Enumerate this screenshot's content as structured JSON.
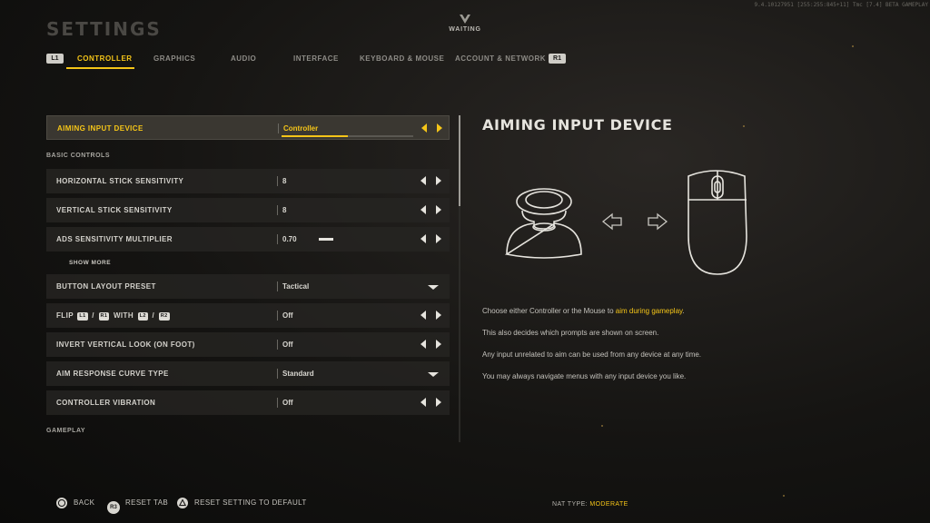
{
  "page_title": "SETTINGS",
  "status": "WAITING",
  "build_info": "9.4.10127951 [255:255:845+11] Tmc [7.4] BETA GAMEPLAY",
  "tabs": {
    "left_bumper": "L1",
    "right_bumper": "R1",
    "items": [
      "CONTROLLER",
      "GRAPHICS",
      "AUDIO",
      "INTERFACE",
      "KEYBOARD & MOUSE",
      "ACCOUNT & NETWORK"
    ],
    "active": "CONTROLLER"
  },
  "settings": {
    "aiming_input_device": {
      "label": "AIMING INPUT DEVICE",
      "value": "Controller",
      "progress": 0.5
    },
    "basic_controls_heading": "BASIC CONTROLS",
    "horizontal_sensitivity": {
      "label": "HORIZONTAL STICK SENSITIVITY",
      "value": "8"
    },
    "vertical_sensitivity": {
      "label": "VERTICAL STICK SENSITIVITY",
      "value": "8"
    },
    "ads_multiplier": {
      "label": "ADS SENSITIVITY MULTIPLIER",
      "value": "0.70"
    },
    "show_more": "SHOW MORE",
    "button_layout": {
      "label": "BUTTON LAYOUT PRESET",
      "value": "Tactical"
    },
    "flip": {
      "label_flip": "FLIP",
      "chip_l1": "L1",
      "slash": "/",
      "chip_r1": "R1",
      "label_with": "WITH",
      "chip_l2": "L2",
      "chip_r2": "R2",
      "value": "Off"
    },
    "invert_vertical": {
      "label": "INVERT VERTICAL LOOK (ON FOOT)",
      "value": "Off"
    },
    "aim_response": {
      "label": "AIM RESPONSE CURVE TYPE",
      "value": "Standard"
    },
    "controller_vibration": {
      "label": "CONTROLLER VIBRATION",
      "value": "Off"
    },
    "gameplay_heading": "GAMEPLAY"
  },
  "detail": {
    "title": "AIMING INPUT DEVICE",
    "line1_prefix": "Choose either Controller or the Mouse to ",
    "line1_highlight": "aim during gameplay",
    "line1_suffix": ".",
    "line2": "This also decides which prompts are shown on screen.",
    "line3": "Any input unrelated to aim can be used from any device at any time.",
    "line4": "You may always navigate menus with any input device you like."
  },
  "footer": {
    "back": "BACK",
    "reset_tab_chip": "R3",
    "reset_tab": "RESET TAB",
    "reset_default": "RESET SETTING TO DEFAULT",
    "nat_label": "NAT TYPE:",
    "nat_value": "MODERATE"
  },
  "colors": {
    "accent": "#f5c518",
    "row_bg": "#262523",
    "text": "#d8d6d0"
  }
}
